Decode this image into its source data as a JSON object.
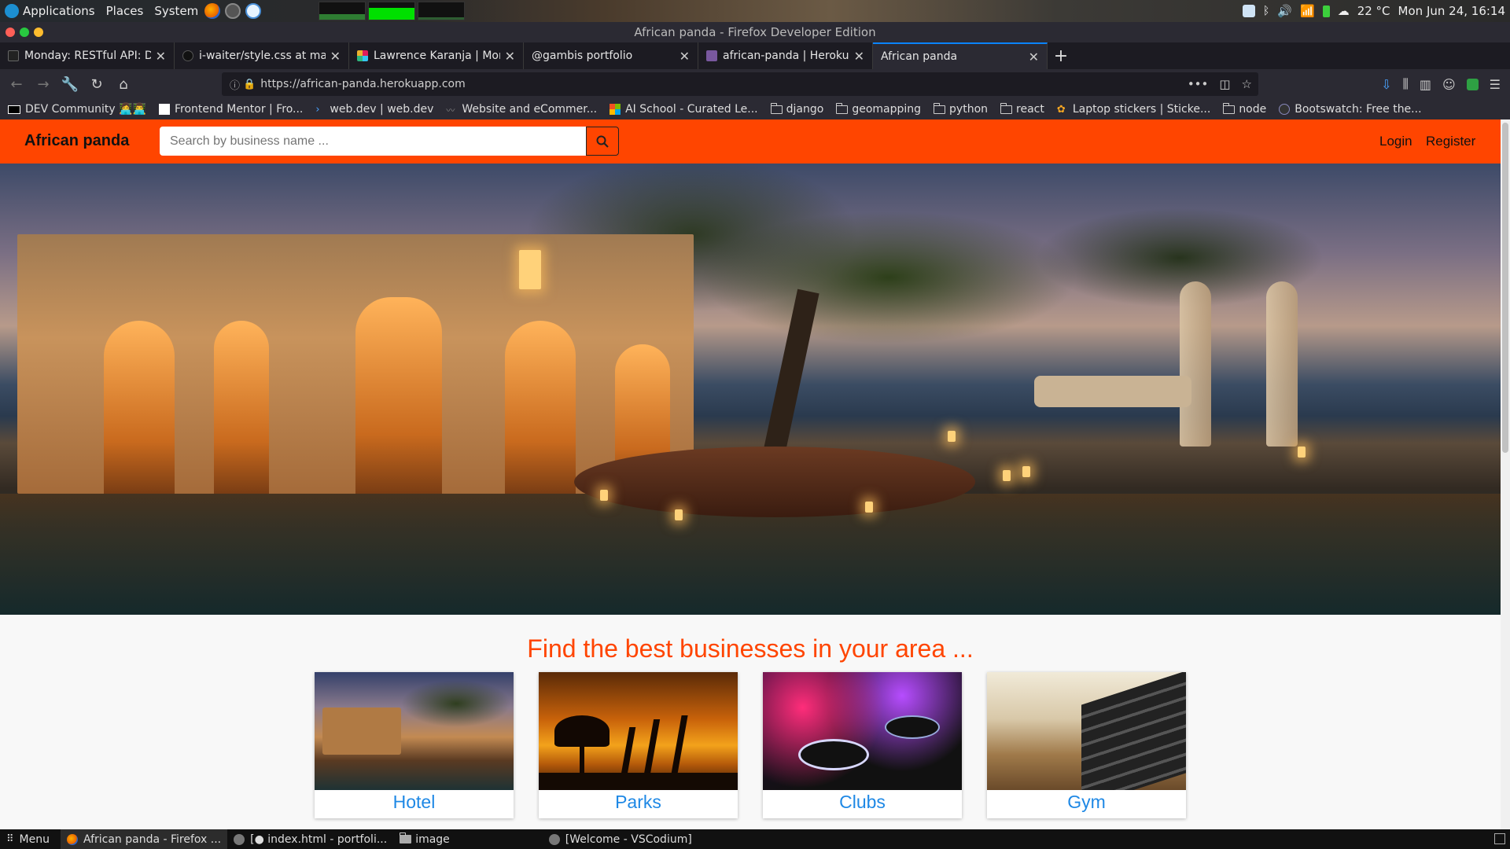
{
  "system_panel": {
    "menus": [
      "Applications",
      "Places",
      "System"
    ],
    "weather": "22 °C",
    "clock": "Mon Jun 24, 16:14"
  },
  "window": {
    "title": "African panda - Firefox Developer Edition"
  },
  "tabs": [
    {
      "title": "Monday: RESTful API: Dj",
      "icon": "dev-favicon"
    },
    {
      "title": "i-waiter/style.css at mas",
      "icon": "github-favicon"
    },
    {
      "title": "Lawrence Karanja | Mori",
      "icon": "slack-favicon"
    },
    {
      "title": "@gambis portfolio",
      "icon": "blank-favicon"
    },
    {
      "title": "african-panda | Heroku",
      "icon": "heroku-favicon"
    },
    {
      "title": "African panda",
      "icon": "blank-favicon",
      "active": true
    }
  ],
  "urlbar": {
    "url": "https://african-panda.herokuapp.com"
  },
  "bookmarks": [
    {
      "label": "DEV Community 👩‍💻👨‍💻",
      "icon": "dev-icon"
    },
    {
      "label": "Frontend Mentor | Fro...",
      "icon": "fm-icon"
    },
    {
      "label": "web.dev  |  web.dev",
      "icon": "webdev-icon"
    },
    {
      "label": "Website and eCommer...",
      "icon": "ecommerce-icon"
    },
    {
      "label": "AI School - Curated Le...",
      "icon": "microsoft-icon"
    },
    {
      "label": "django",
      "icon": "folder-icon"
    },
    {
      "label": "geomapping",
      "icon": "folder-icon"
    },
    {
      "label": "python",
      "icon": "folder-icon"
    },
    {
      "label": "react",
      "icon": "folder-icon"
    },
    {
      "label": "Laptop stickers | Sticke...",
      "icon": "sticker-icon"
    },
    {
      "label": "node",
      "icon": "folder-icon"
    },
    {
      "label": "Bootswatch: Free the...",
      "icon": "bootswatch-icon"
    }
  ],
  "site": {
    "brand": "African panda",
    "search_placeholder": "Search by business name ...",
    "login": "Login",
    "register": "Register",
    "tagline": "Find the best businesses in your area ...",
    "categories": [
      {
        "label": "Hotel",
        "image": "hotel-photo"
      },
      {
        "label": "Parks",
        "image": "giraffe-sunset-photo"
      },
      {
        "label": "Clubs",
        "image": "dj-deck-photo"
      },
      {
        "label": "Gym",
        "image": "dumbbell-rack-photo"
      }
    ],
    "colors": {
      "primary": "#ff4500",
      "link": "#1e88e5"
    }
  },
  "taskbar": {
    "menu": "Menu",
    "tasks": [
      {
        "label": "African panda - Firefox ...",
        "icon": "firefox-icon",
        "active": true
      },
      {
        "label": "[● index.html - portfoli...",
        "icon": "vscodium-icon"
      },
      {
        "label": "image",
        "icon": "folder-icon"
      },
      {
        "label": "[Welcome - VSCodium]",
        "icon": "vscodium-icon"
      }
    ]
  }
}
